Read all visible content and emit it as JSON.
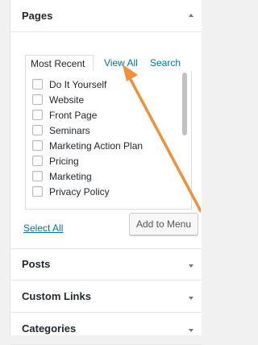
{
  "sections": {
    "pages": {
      "title": "Pages"
    },
    "posts": {
      "title": "Posts"
    },
    "custom_links": {
      "title": "Custom Links"
    },
    "categories": {
      "title": "Categories"
    }
  },
  "tabs": {
    "most_recent": "Most Recent",
    "view_all": "View All",
    "search": "Search"
  },
  "pages_list": [
    "Do It Yourself",
    "Website",
    "Front Page",
    "Seminars",
    "Marketing Action Plan",
    "Pricing",
    "Marketing",
    "Privacy Policy"
  ],
  "actions": {
    "select_all": "Select All",
    "add_to_menu": "Add to Menu"
  },
  "colors": {
    "link": "#0073aa",
    "annotation_arrow": "#f0913a"
  }
}
